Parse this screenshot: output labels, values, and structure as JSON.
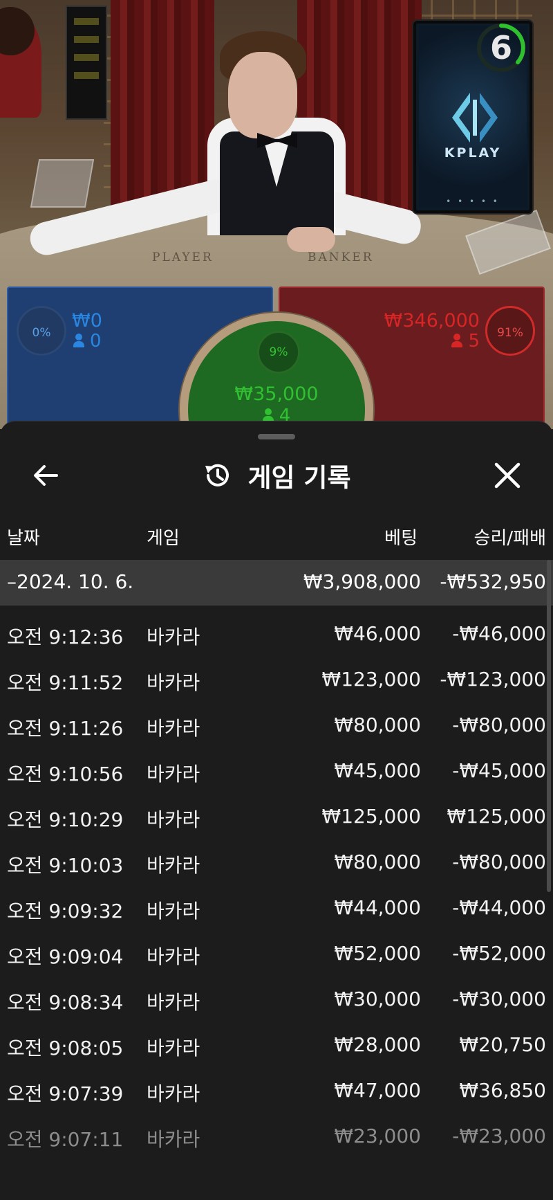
{
  "monitor": {
    "countdown": "6",
    "logo": "KPLAY",
    "dots": "• • • • •"
  },
  "table": {
    "player_word": "PLAYER",
    "banker_word": "BANKER"
  },
  "bets": {
    "player": {
      "percent": "0%",
      "amount": "₩0",
      "count": "0",
      "color": "#2a86e0"
    },
    "banker": {
      "percent": "91%",
      "amount": "₩346,000",
      "count": "5",
      "color": "#d82626"
    },
    "tie": {
      "percent": "9%",
      "amount": "₩35,000",
      "count": "4",
      "color": "#31c031"
    }
  },
  "history": {
    "title": "게임 기록",
    "icons": {
      "back": "back-arrow-icon",
      "history": "history-clock-icon",
      "close": "close-icon"
    },
    "headers": {
      "date": "날짜",
      "game": "게임",
      "bet": "베팅",
      "result": "승리/패배"
    },
    "date_group": {
      "label": "–2024. 10. 6.",
      "bet": "₩3,908,000",
      "result": "-₩532,950"
    },
    "rows": [
      {
        "time": "오전 9:12:36",
        "game": "바카라",
        "bet": "₩46,000",
        "result": "-₩46,000"
      },
      {
        "time": "오전 9:11:52",
        "game": "바카라",
        "bet": "₩123,000",
        "result": "-₩123,000"
      },
      {
        "time": "오전 9:11:26",
        "game": "바카라",
        "bet": "₩80,000",
        "result": "-₩80,000"
      },
      {
        "time": "오전 9:10:56",
        "game": "바카라",
        "bet": "₩45,000",
        "result": "-₩45,000"
      },
      {
        "time": "오전 9:10:29",
        "game": "바카라",
        "bet": "₩125,000",
        "result": "₩125,000"
      },
      {
        "time": "오전 9:10:03",
        "game": "바카라",
        "bet": "₩80,000",
        "result": "-₩80,000"
      },
      {
        "time": "오전 9:09:32",
        "game": "바카라",
        "bet": "₩44,000",
        "result": "-₩44,000"
      },
      {
        "time": "오전 9:09:04",
        "game": "바카라",
        "bet": "₩52,000",
        "result": "-₩52,000"
      },
      {
        "time": "오전 9:08:34",
        "game": "바카라",
        "bet": "₩30,000",
        "result": "-₩30,000"
      },
      {
        "time": "오전 9:08:05",
        "game": "바카라",
        "bet": "₩28,000",
        "result": "₩20,750"
      },
      {
        "time": "오전 9:07:39",
        "game": "바카라",
        "bet": "₩47,000",
        "result": "₩36,850"
      },
      {
        "time": "오전 9:07:11",
        "game": "바카라",
        "bet": "₩23,000",
        "result": "-₩23,000"
      }
    ]
  }
}
